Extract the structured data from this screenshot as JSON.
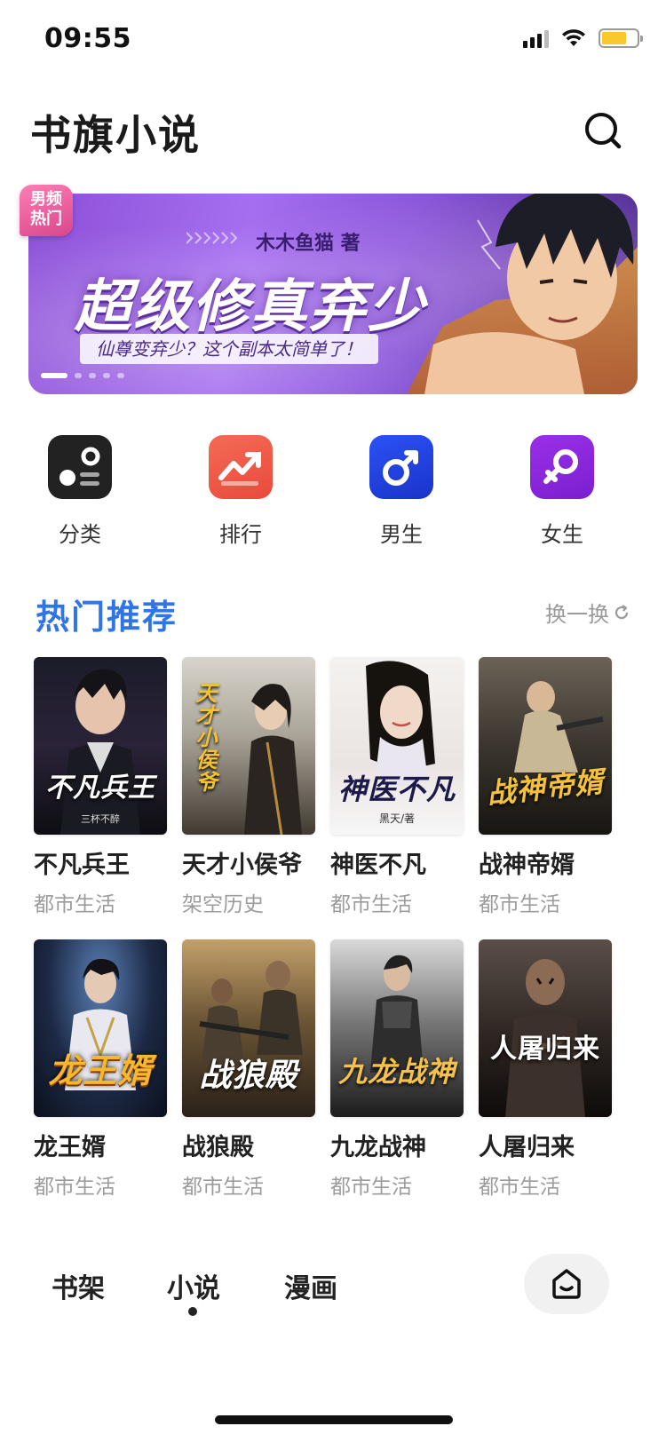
{
  "status_bar": {
    "time": "09:55"
  },
  "header": {
    "title": "书旗小说"
  },
  "banner": {
    "tag": "男频热门",
    "author": "木木鱼猫 著",
    "book_title": "超级修真弃少",
    "tagline": "仙尊变弃少？这个副本太简单了！",
    "slide_count": 5,
    "active_slide": 0
  },
  "categories": [
    {
      "label": "分类",
      "icon": "category-icon",
      "color": "#222222"
    },
    {
      "label": "排行",
      "icon": "ranking-icon",
      "color": "#f0604a"
    },
    {
      "label": "男生",
      "icon": "male-icon",
      "color": "#2142e8"
    },
    {
      "label": "女生",
      "icon": "female-icon",
      "color": "#8a2be2"
    }
  ],
  "recommend": {
    "title": "热门推荐",
    "refresh_label": "换一换",
    "books": [
      {
        "name": "不凡兵王",
        "genre": "都市生活",
        "cover_text": "不凡兵王",
        "cover_author": "三杯不醉"
      },
      {
        "name": "天才小侯爷",
        "genre": "架空历史",
        "cover_text": "天才小侯爷",
        "cover_author": ""
      },
      {
        "name": "神医不凡",
        "genre": "都市生活",
        "cover_text": "神医不凡",
        "cover_author": "黑天/著"
      },
      {
        "name": "战神帝婿",
        "genre": "都市生活",
        "cover_text": "战神帝婿",
        "cover_author": ""
      },
      {
        "name": "龙王婿",
        "genre": "都市生活",
        "cover_text": "龙王婿",
        "cover_author": ""
      },
      {
        "name": "战狼殿",
        "genre": "都市生活",
        "cover_text": "战狼殿",
        "cover_author": ""
      },
      {
        "name": "九龙战神",
        "genre": "都市生活",
        "cover_text": "九龙战神",
        "cover_author": ""
      },
      {
        "name": "人屠归来",
        "genre": "都市生活",
        "cover_text": "人屠归来",
        "cover_author": ""
      }
    ]
  },
  "tabbar": {
    "tabs": [
      "书架",
      "小说",
      "漫画"
    ],
    "active_tab": "小说"
  }
}
